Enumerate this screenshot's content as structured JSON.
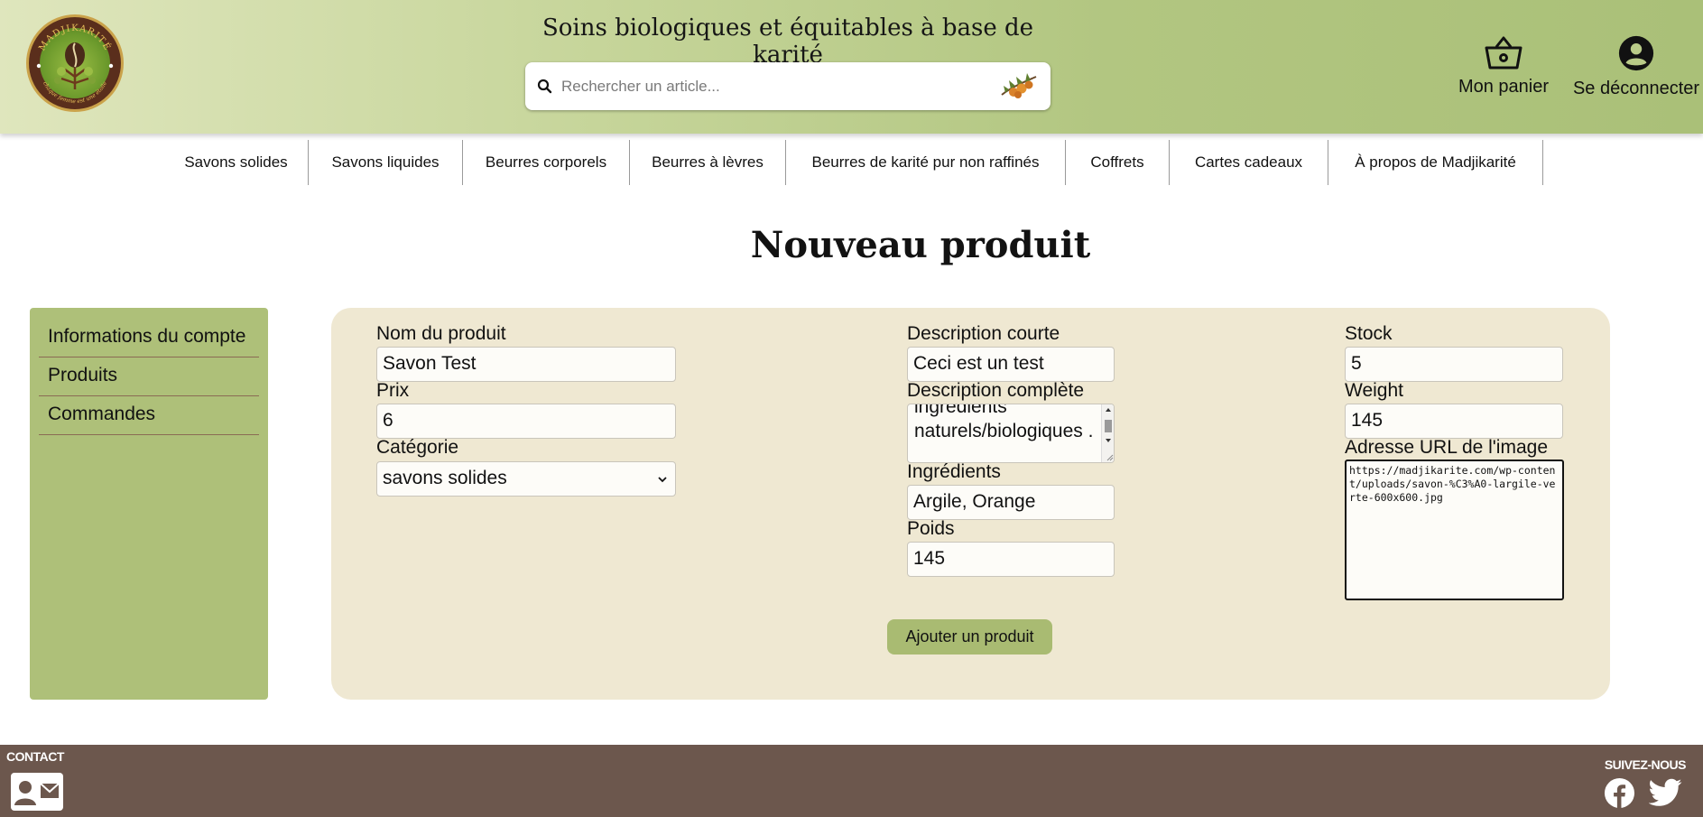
{
  "header": {
    "tagline": "Soins biologiques et équitables à base de karité",
    "search_placeholder": "Rechercher un article...",
    "cart_label": "Mon panier",
    "logout_label": "Se déconnecter",
    "logo_text_top": "MADJIKARITÉ",
    "logo_text_bottom": "chaque femme est une étoile",
    "icons": {
      "search": "search-icon",
      "cart": "basket-icon",
      "account": "user-circle-icon",
      "shea": "shea-fruit-icon"
    }
  },
  "nav": {
    "items": [
      {
        "label": "Savons solides"
      },
      {
        "label": "Savons liquides"
      },
      {
        "label": "Beurres corporels"
      },
      {
        "label": "Beurres à lèvres"
      },
      {
        "label": "Beurres de karité pur non raffinés"
      },
      {
        "label": "Coffrets"
      },
      {
        "label": "Cartes cadeaux"
      },
      {
        "label": "À propos de Madjikarité"
      }
    ]
  },
  "main": {
    "title": "Nouveau produit"
  },
  "sidebar": {
    "items": [
      {
        "label": "Informations du compte"
      },
      {
        "label": "Produits"
      },
      {
        "label": "Commandes"
      }
    ]
  },
  "form": {
    "name_label": "Nom du produit",
    "name_value": "Savon Test",
    "price_label": "Prix",
    "price_value": "6",
    "category_label": "Catégorie",
    "category_value": "savons solides",
    "short_desc_label": "Description courte",
    "short_desc_value": "Ceci est un test",
    "full_desc_label": "Description complète",
    "full_desc_value": "ingrédients naturels/biologiques .",
    "ingredients_label": "Ingrédients",
    "ingredients_value": "Argile, Orange",
    "weight_fr_label": "Poids",
    "weight_fr_value": "145",
    "stock_label": "Stock",
    "stock_value": "5",
    "weight_label": "Weight",
    "weight_value": "145",
    "image_url_label": "Adresse URL de l'image",
    "image_url_value": "https://madjikarite.com/wp-content/uploads/savon-%C3%A0-largile-verte-600x600.jpg",
    "submit_label": "Ajouter un produit"
  },
  "footer": {
    "contact_title": "CONTACT",
    "follow_title": "SUIVEZ-NOUS",
    "icons": {
      "contact": "contact-card-icon",
      "facebook": "facebook-icon",
      "twitter": "twitter-icon"
    }
  },
  "colors": {
    "header_green": "#b2c681",
    "sidebar_green": "#aec079",
    "panel_beige": "#efe8d2",
    "button_green": "#a9bb72",
    "footer_brown": "#6c574d"
  }
}
